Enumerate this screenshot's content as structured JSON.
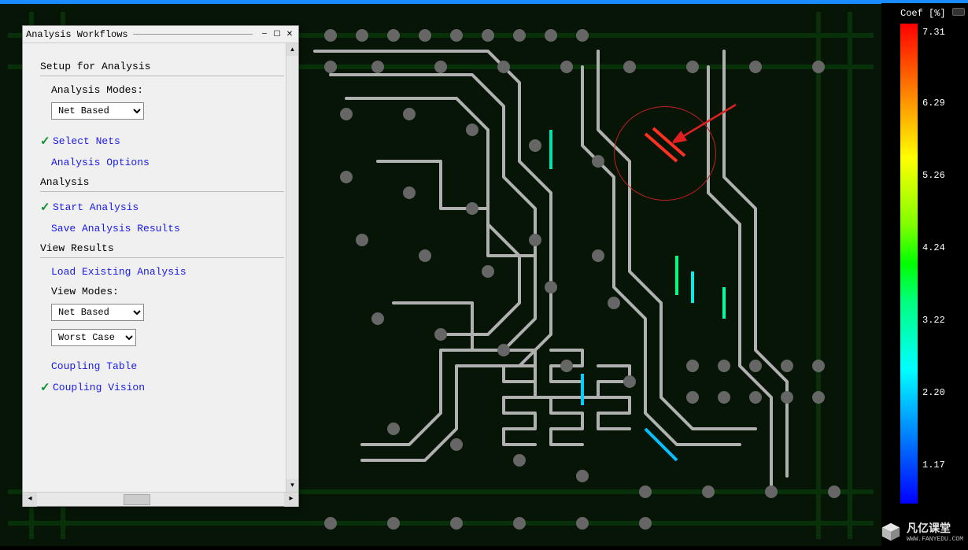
{
  "panel": {
    "title": "Analysis Workflows",
    "sections": {
      "setup": "Setup for Analysis",
      "analysis": "Analysis",
      "view": "View Results"
    },
    "labels": {
      "analysis_modes": "Analysis Modes:",
      "view_modes": "View Modes:"
    },
    "dropdowns": {
      "analysis_mode": "Net Based",
      "view_mode": "Net Based",
      "view_case": "Worst Case"
    },
    "links": {
      "select_nets": "Select Nets",
      "analysis_options": "Analysis Options",
      "start_analysis": "Start Analysis",
      "save_results": "Save Analysis Results",
      "load_existing": "Load Existing Analysis",
      "coupling_table": "Coupling Table",
      "coupling_vision": "Coupling Vision"
    },
    "checked": {
      "select_nets": true,
      "start_analysis": true,
      "coupling_vision": true
    }
  },
  "legend": {
    "title": "Coef [%]",
    "ticks": [
      "7.31",
      "6.29",
      "5.26",
      "4.24",
      "3.22",
      "2.20",
      "1.17"
    ]
  },
  "watermark": {
    "brand": "凡亿课堂",
    "url": "WWW.FANYEDU.COM"
  },
  "icons": {
    "minimize": "—",
    "dock": "☐",
    "close": "✕",
    "check": "✓"
  }
}
